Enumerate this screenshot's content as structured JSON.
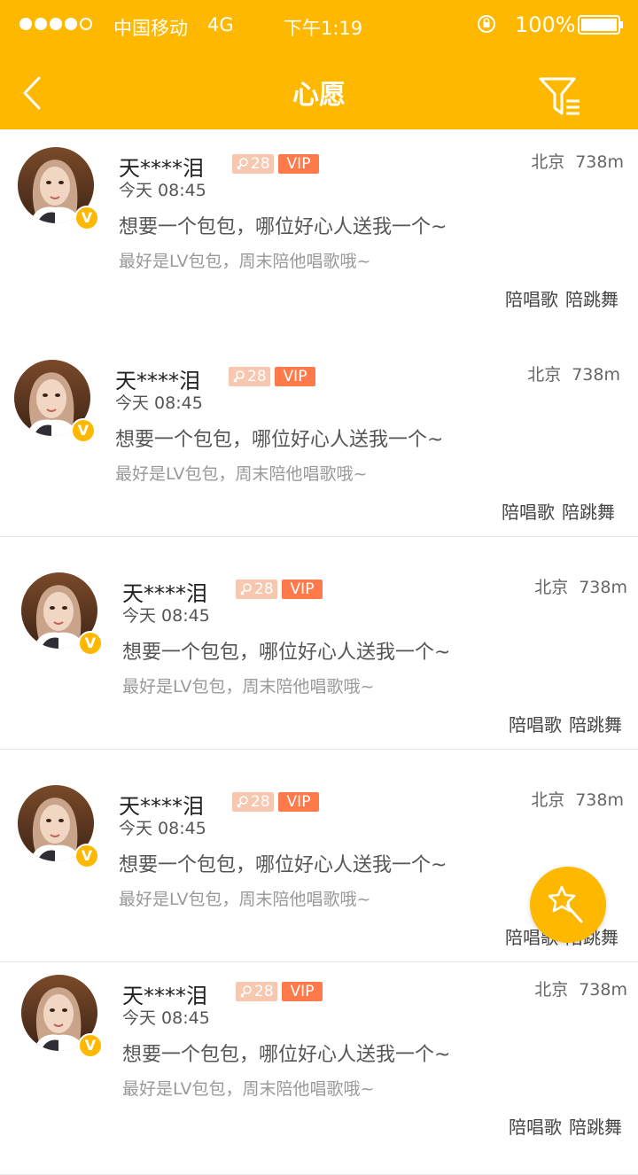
{
  "status_bar": {
    "carrier": "中国移动",
    "network": "4G",
    "time": "下午1:19",
    "battery": "100%"
  },
  "nav": {
    "title": "心愿"
  },
  "colors": {
    "brand": "#FFB800",
    "vip": "#FF7A4A",
    "age_badge": "#F8C7B0"
  },
  "wishes": [
    {
      "name": "天****泪",
      "age": "28",
      "vip": "VIP",
      "time": "今天 08:45",
      "title": "想要一个包包，哪位好心人送我一个~",
      "subtitle": "最好是LV包包，周末陪他唱歌哦~",
      "city": "北京",
      "distance": "738m",
      "tags": [
        "陪唱歌",
        "陪跳舞"
      ]
    },
    {
      "name": "天****泪",
      "age": "28",
      "vip": "VIP",
      "time": "今天 08:45",
      "title": "想要一个包包，哪位好心人送我一个~",
      "subtitle": "最好是LV包包，周末陪他唱歌哦~",
      "city": "北京",
      "distance": "738m",
      "tags": [
        "陪唱歌",
        "陪跳舞"
      ]
    },
    {
      "name": "天****泪",
      "age": "28",
      "vip": "VIP",
      "time": "今天 08:45",
      "title": "想要一个包包，哪位好心人送我一个~",
      "subtitle": "最好是LV包包，周末陪他唱歌哦~",
      "city": "北京",
      "distance": "738m",
      "tags": [
        "陪唱歌",
        "陪跳舞"
      ]
    },
    {
      "name": "天****泪",
      "age": "28",
      "vip": "VIP",
      "time": "今天 08:45",
      "title": "想要一个包包，哪位好心人送我一个~",
      "subtitle": "最好是LV包包，周末陪他唱歌哦~",
      "city": "北京",
      "distance": "738m",
      "tags": [
        "陪唱歌",
        "陪跳舞"
      ]
    },
    {
      "name": "天****泪",
      "age": "28",
      "vip": "VIP",
      "time": "今天 08:45",
      "title": "想要一个包包，哪位好心人送我一个~",
      "subtitle": "最好是LV包包，周末陪他唱歌哦~",
      "city": "北京",
      "distance": "738m",
      "tags": [
        "陪唱歌",
        "陪跳舞"
      ]
    }
  ]
}
